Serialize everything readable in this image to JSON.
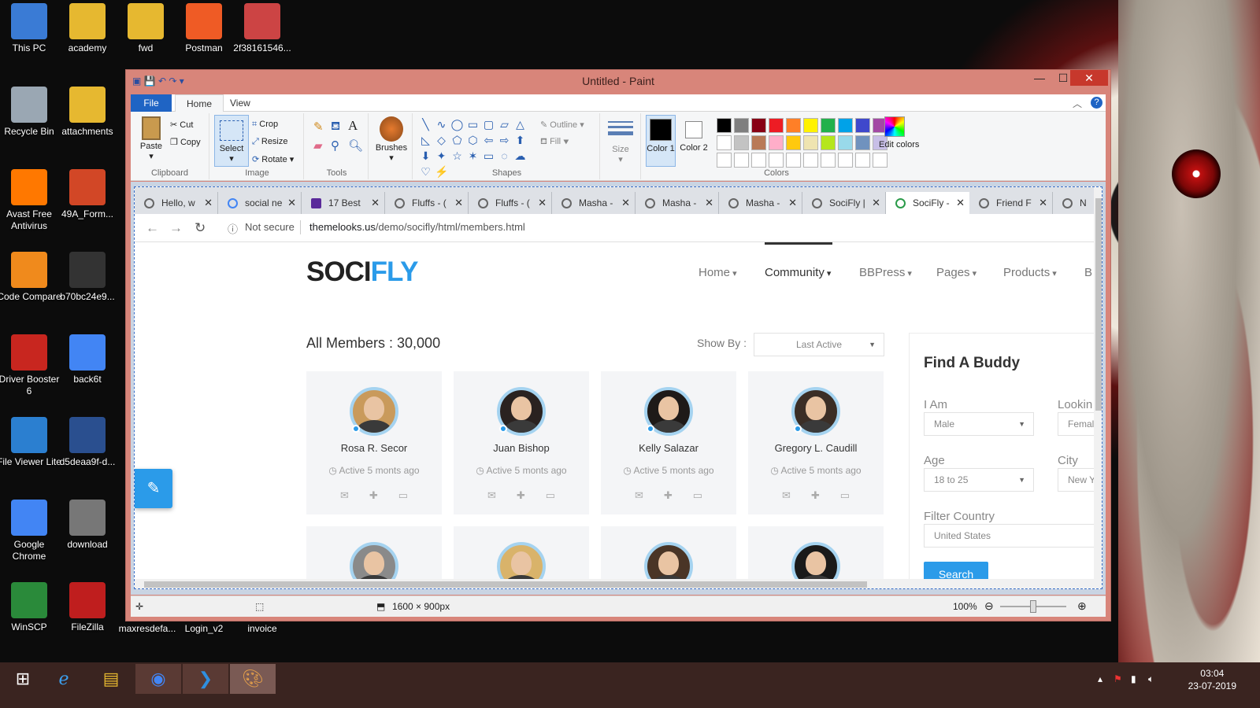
{
  "desktop": {
    "icons": [
      {
        "label": "This PC",
        "color": "#3a7bd5"
      },
      {
        "label": "academy",
        "color": "#e6b830"
      },
      {
        "label": "fwd",
        "color": "#e6b830"
      },
      {
        "label": "Postman",
        "color": "#ef5b25"
      },
      {
        "label": "2f38161546...",
        "color": "#c44"
      },
      {
        "label": "Recycle Bin",
        "color": "#9aa7b3"
      },
      {
        "label": "attachments",
        "color": "#e6b830"
      },
      {
        "label": "Avast Free Antivirus",
        "color": "#ff7800"
      },
      {
        "label": "49A_Form...",
        "color": "#d24726"
      },
      {
        "label": "Code Compare",
        "color": "#f08a1c"
      },
      {
        "label": "b70bc24e9...",
        "color": "#333"
      },
      {
        "label": "Driver Booster 6",
        "color": "#c8261f"
      },
      {
        "label": "back6t",
        "color": "#4285f4"
      },
      {
        "label": "File Viewer Lite",
        "color": "#2b7fd0"
      },
      {
        "label": "d5deaa9f-d...",
        "color": "#2a4f8f"
      },
      {
        "label": "Google Chrome",
        "color": "#4285f4"
      },
      {
        "label": "download",
        "color": "#777"
      },
      {
        "label": "WinSCP",
        "color": "#2a8a3a"
      },
      {
        "label": "FileZilla",
        "color": "#bf1e1e"
      },
      {
        "label": "maxresdefa...",
        "color": "#000"
      },
      {
        "label": "Login_v2",
        "color": "#000"
      },
      {
        "label": "invoice",
        "color": "#000"
      }
    ]
  },
  "paint": {
    "title": "Untitled - Paint",
    "window_controls": {
      "minimize": "—",
      "maximize": "☐",
      "close": "✕"
    },
    "tabs": [
      "File",
      "Home",
      "View"
    ],
    "clipboard": {
      "paste": "Paste",
      "cut": "Cut",
      "copy": "Copy",
      "group": "Clipboard"
    },
    "image": {
      "select": "Select",
      "crop": "Crop",
      "resize": "Resize",
      "rotate": "Rotate",
      "group": "Image"
    },
    "tools": {
      "group": "Tools"
    },
    "brushes": "Brushes",
    "shapes": {
      "outline": "Outline",
      "fill": "Fill",
      "group": "Shapes"
    },
    "size": "Size",
    "color1": "Color 1",
    "color2": "Color 2",
    "colors_group": "Colors",
    "edit_colors": "Edit colors",
    "palette": [
      "#000000",
      "#7f7f7f",
      "#880015",
      "#ed1c24",
      "#ff7f27",
      "#fff200",
      "#22b14c",
      "#00a2e8",
      "#3f48cc",
      "#a349a4",
      "#ffffff",
      "#c3c3c3",
      "#b97a57",
      "#ffaec9",
      "#ffc90e",
      "#efe4b0",
      "#b5e61d",
      "#99d9ea",
      "#7092be",
      "#c8bfe7"
    ],
    "status": {
      "dimensions": "1600 × 900px",
      "zoom": "100%"
    }
  },
  "browser": {
    "tabs": [
      {
        "label": "Hello, w"
      },
      {
        "label": "social ne"
      },
      {
        "label": "17 Best"
      },
      {
        "label": "Fluffs - ("
      },
      {
        "label": "Fluffs - ("
      },
      {
        "label": "Masha -"
      },
      {
        "label": "Masha -"
      },
      {
        "label": "Masha -"
      },
      {
        "label": "SociFly |"
      },
      {
        "label": "SociFly -"
      },
      {
        "label": "Friend F"
      },
      {
        "label": "N"
      }
    ],
    "security": "Not secure",
    "url_domain": "themelooks.us",
    "url_path": "/demo/socifly/html/members.html"
  },
  "site": {
    "logo_a": "SOCI",
    "logo_b": "FLY",
    "nav": [
      "Home",
      "Community",
      "BBPress",
      "Pages",
      "Products",
      "B"
    ],
    "members_title": "All Members : 30,000",
    "show_by_label": "Show By :",
    "show_by_value": "Last Active",
    "members": [
      {
        "name": "Rosa R. Secor",
        "status": "Active 5 monts ago",
        "hair": "#c99a5b"
      },
      {
        "name": "Juan Bishop",
        "status": "Active 5 monts ago",
        "hair": "#2a2220"
      },
      {
        "name": "Kelly Salazar",
        "status": "Active 5 monts ago",
        "hair": "#1e1a18"
      },
      {
        "name": "Gregory L. Caudill",
        "status": "Active 5 monts ago",
        "hair": "#3b2e26"
      }
    ],
    "members_row2_hair": [
      "#8a8a8a",
      "#d9b36a",
      "#4a3526",
      "#1a1a1a"
    ],
    "sidebar": {
      "title": "Find A Buddy",
      "i_am_label": "I Am",
      "i_am_value": "Male",
      "looking_label": "Lookin",
      "looking_value": "Femal",
      "age_label": "Age",
      "age_value": "18 to 25",
      "city_label": "City",
      "city_value": "New Y",
      "country_label": "Filter Country",
      "country_value": "United States",
      "search_button": "Search"
    }
  },
  "taskbar": {
    "time": "03:04",
    "date": "23-07-2019"
  }
}
